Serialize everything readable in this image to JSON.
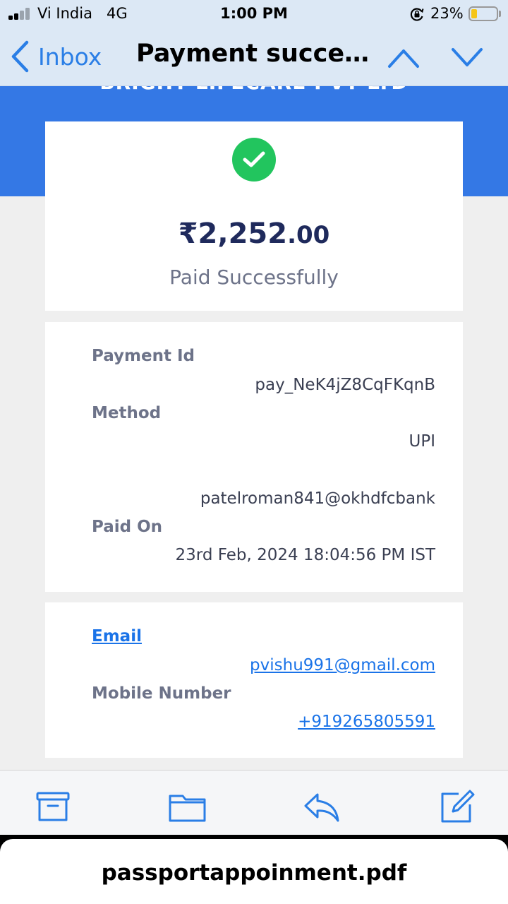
{
  "status_bar": {
    "carrier": "Vi India",
    "network": "4G",
    "time": "1:00 PM",
    "battery_percent": "23%",
    "battery_level": 0.23
  },
  "nav": {
    "back_label": "Inbox",
    "title": "Payment succes..."
  },
  "email": {
    "brand_name": "BRIGHT LIFECARE PVT LTD",
    "amount_card": {
      "amount_main": "₹2,252",
      "amount_decimal": ".00",
      "status": "Paid Successfully"
    },
    "details": {
      "payment_id_label": "Payment Id",
      "payment_id_value": "pay_NeK4jZ8CqFKqnB",
      "method_label": "Method",
      "method_value": "UPI",
      "upi_id": "patelroman841@okhdfcbank",
      "paid_on_label": "Paid On",
      "paid_on_value": "23rd Feb, 2024 18:04:56 PM IST"
    },
    "contact": {
      "email_label": "Email",
      "email_value": "pvishu991@gmail.com",
      "mobile_label": "Mobile Number",
      "mobile_value": "+919265805591"
    }
  },
  "toolbar": {
    "icons": [
      "archive-icon",
      "folder-icon",
      "reply-icon",
      "compose-icon"
    ]
  },
  "attachment": {
    "filename": "passportappoinment.pdf"
  },
  "colors": {
    "brand_blue": "#3478e5",
    "success_green": "#22c55e",
    "ios_blue": "#2a7ee6",
    "link_blue": "#1a73e8",
    "amount_navy": "#1f2a5c"
  }
}
